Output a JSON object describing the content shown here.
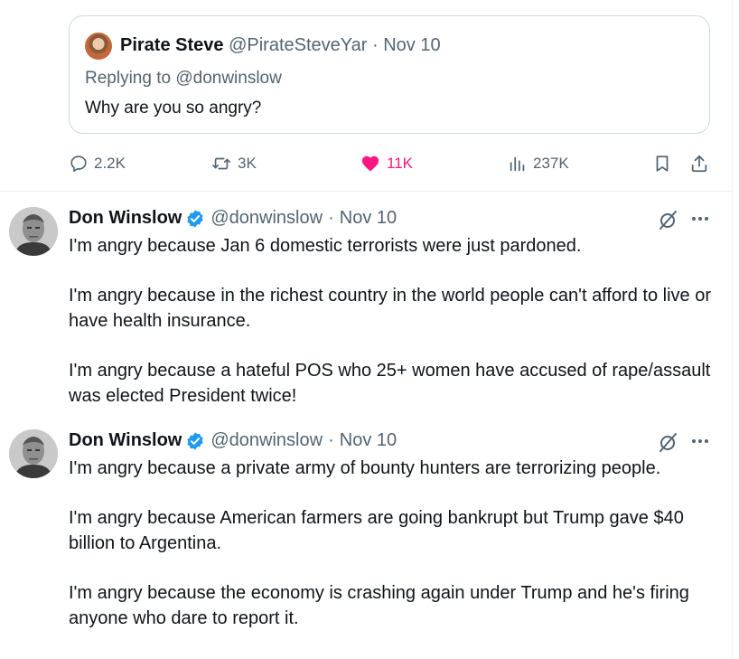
{
  "quoted_tweet": {
    "name": "Pirate Steve",
    "handle": "@PirateSteveYar",
    "dot": "·",
    "date": "Nov 10",
    "replying_to": "Replying to @donwinslow",
    "text": "Why are you so angry?"
  },
  "actions": {
    "replies": "2.2K",
    "reposts": "3K",
    "likes": "11K",
    "views": "237K"
  },
  "tweets": [
    {
      "name": "Don Winslow",
      "handle": "@donwinslow",
      "dot": "·",
      "date": "Nov 10",
      "paragraphs": [
        "I'm angry because Jan 6 domestic terrorists were just pardoned.",
        "I'm angry because in the richest country in the world people can't afford to live or have health insurance.",
        "I'm angry because a hateful POS who 25+ women have accused of rape/assault was elected President twice!"
      ]
    },
    {
      "name": "Don Winslow",
      "handle": "@donwinslow",
      "dot": "·",
      "date": "Nov 10",
      "paragraphs": [
        "I'm angry because a private army of bounty hunters are terrorizing people.",
        "I'm angry because American farmers are going bankrupt but Trump gave $40 billion to Argentina.",
        "I'm angry because the economy is crashing again under Trump and he's firing anyone who dare to report it."
      ]
    }
  ],
  "colors": {
    "like_active": "#f91880",
    "verified": "#1d9bf0",
    "secondary_text": "#536471"
  },
  "icons": [
    "reply-icon",
    "repost-icon",
    "like-icon",
    "views-icon",
    "bookmark-icon",
    "share-icon",
    "verified-icon",
    "grok-icon",
    "more-icon"
  ]
}
